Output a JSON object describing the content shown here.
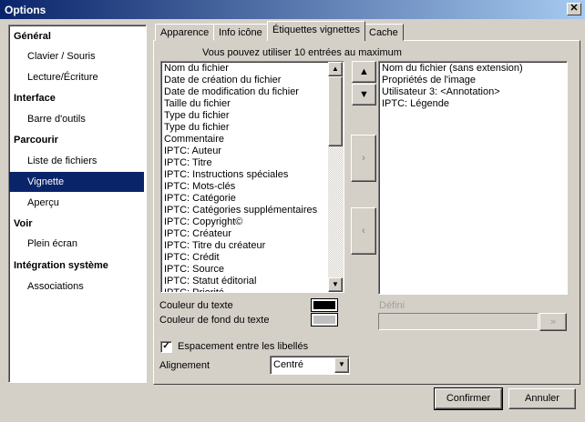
{
  "window": {
    "title": "Options",
    "close": "✕"
  },
  "sidebar": {
    "items": [
      {
        "label": "Général",
        "type": "h"
      },
      {
        "label": "Clavier / Souris",
        "type": "s"
      },
      {
        "label": "Lecture/Écriture",
        "type": "s"
      },
      {
        "label": "Interface",
        "type": "h"
      },
      {
        "label": "Barre d'outils",
        "type": "s"
      },
      {
        "label": "Parcourir",
        "type": "h"
      },
      {
        "label": "Liste de fichiers",
        "type": "s"
      },
      {
        "label": "Vignette",
        "type": "s",
        "selected": true
      },
      {
        "label": "Aperçu",
        "type": "s"
      },
      {
        "label": "Voir",
        "type": "h"
      },
      {
        "label": "Plein écran",
        "type": "s"
      },
      {
        "label": "Intégration système",
        "type": "h"
      },
      {
        "label": "Associations",
        "type": "s"
      }
    ]
  },
  "tabs": [
    "Apparence",
    "Info icône",
    "Étiquettes vignettes",
    "Cache"
  ],
  "content": {
    "hint": "Vous pouvez utiliser 10 entrées au maximum",
    "available": [
      "Nom du fichier",
      "Date de création du fichier",
      "Date de modification du fichier",
      "Taille du fichier",
      "Type du fichier",
      "Type du fichier",
      "Commentaire",
      "IPTC: Auteur",
      "IPTC: Titre",
      "IPTC: Instructions spéciales",
      "IPTC: Mots-clés",
      "IPTC: Catégorie",
      "IPTC: Catégories supplémentaires",
      "IPTC: Copyright©",
      "IPTC: Créateur",
      "IPTC: Titre du créateur",
      "IPTC: Crédit",
      "IPTC: Source",
      "IPTC: Statut éditorial",
      "IPTC: Priorité"
    ],
    "selected": [
      "Nom du fichier (sans extension)",
      "Propriétés de l'image",
      "Utilisateur 3: <Annotation>",
      "IPTC: Légende"
    ],
    "add": "›",
    "remove": "‹",
    "up": "▲",
    "down": "▼",
    "text_color_label": "Couleur du texte",
    "text_color": "#000000",
    "bg_color_label": "Couleur de fond du texte",
    "bg_color": "#c0c0c0",
    "define_label": "Défini",
    "define_btn": "»",
    "spacing_label": "Espacement entre les libellés",
    "spacing_checked": true,
    "align_label": "Alignement",
    "align_value": "Centré"
  },
  "footer": {
    "ok": "Confirmer",
    "cancel": "Annuler"
  }
}
